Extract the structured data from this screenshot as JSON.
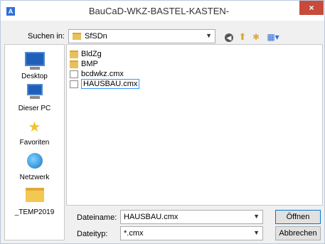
{
  "window": {
    "title": "BauCaD-WKZ-BASTEL-KASTEN-",
    "app_icon": "A",
    "close_label": "×"
  },
  "toolbar": {
    "look_in_label": "Suchen in:",
    "look_in_value": "SfSDn"
  },
  "places": [
    {
      "label": "Desktop",
      "icon": "desktop-icon"
    },
    {
      "label": "Dieser PC",
      "icon": "computer-icon"
    },
    {
      "label": "Favoriten",
      "icon": "star-folder-icon"
    },
    {
      "label": "Netzwerk",
      "icon": "network-icon"
    },
    {
      "label": "_TEMP2019",
      "icon": "folder-icon"
    }
  ],
  "files": [
    {
      "name": "BldZg",
      "type": "folder"
    },
    {
      "name": "BMP",
      "type": "folder"
    },
    {
      "name": "bcdwkz.cmx",
      "type": "file"
    },
    {
      "name": "HAUSBAU.cmx",
      "type": "file",
      "selected": true
    }
  ],
  "bottom": {
    "filename_label": "Dateiname:",
    "filename_value": "HAUSBAU.cmx",
    "filetype_label": "Dateityp:",
    "filetype_value": "*.cmx",
    "open_label": "Öffnen",
    "cancel_label": "Abbrechen"
  }
}
